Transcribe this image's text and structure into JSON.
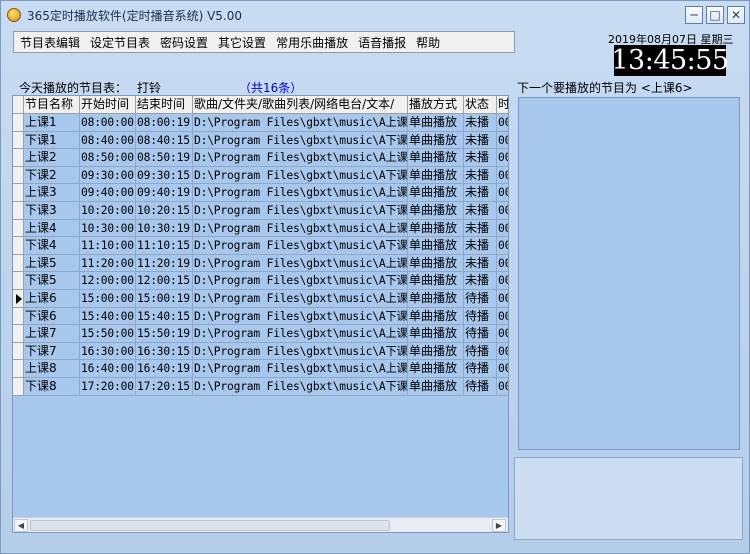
{
  "window": {
    "title": "365定时播放软件(定时播音系统) V5.00",
    "min_glyph": "─",
    "max_glyph": "□",
    "close_glyph": "✕"
  },
  "menu": [
    {
      "label": "节目表编辑"
    },
    {
      "label": "设定节目表"
    },
    {
      "label": "密码设置"
    },
    {
      "label": "其它设置"
    },
    {
      "label": "常用乐曲播放"
    },
    {
      "label": "语音播报"
    },
    {
      "label": "帮助"
    }
  ],
  "clock": {
    "date": "2019年08月07日 星期三",
    "time": "13:45:55"
  },
  "today": {
    "label": "今天播放的节目表：",
    "value": "打铃",
    "count": "（共16条）"
  },
  "next": {
    "label": "下一个要播放的节目为 <上课6>"
  },
  "table": {
    "headers": [
      "节目名称",
      "开始时间",
      "结束时间",
      "歌曲/文件夹/歌曲列表/网络电台/文本/",
      "播放方式",
      "状态",
      "时"
    ],
    "rows": [
      {
        "name": "上课1",
        "start": "08:00:00",
        "end": "08:00:19",
        "path": "D:\\Program Files\\gbxt\\music\\A上课",
        "mode": "单曲播放",
        "status": "未播",
        "extra": "00"
      },
      {
        "name": "下课1",
        "start": "08:40:00",
        "end": "08:40:15",
        "path": "D:\\Program Files\\gbxt\\music\\A下课",
        "mode": "单曲播放",
        "status": "未播",
        "extra": "00"
      },
      {
        "name": "上课2",
        "start": "08:50:00",
        "end": "08:50:19",
        "path": "D:\\Program Files\\gbxt\\music\\A上课",
        "mode": "单曲播放",
        "status": "未播",
        "extra": "00"
      },
      {
        "name": "下课2",
        "start": "09:30:00",
        "end": "09:30:15",
        "path": "D:\\Program Files\\gbxt\\music\\A下课",
        "mode": "单曲播放",
        "status": "未播",
        "extra": "00"
      },
      {
        "name": "上课3",
        "start": "09:40:00",
        "end": "09:40:19",
        "path": "D:\\Program Files\\gbxt\\music\\A上课",
        "mode": "单曲播放",
        "status": "未播",
        "extra": "00"
      },
      {
        "name": "下课3",
        "start": "10:20:00",
        "end": "10:20:15",
        "path": "D:\\Program Files\\gbxt\\music\\A下课",
        "mode": "单曲播放",
        "status": "未播",
        "extra": "00"
      },
      {
        "name": "上课4",
        "start": "10:30:00",
        "end": "10:30:19",
        "path": "D:\\Program Files\\gbxt\\music\\A上课",
        "mode": "单曲播放",
        "status": "未播",
        "extra": "00"
      },
      {
        "name": "下课4",
        "start": "11:10:00",
        "end": "11:10:15",
        "path": "D:\\Program Files\\gbxt\\music\\A下课",
        "mode": "单曲播放",
        "status": "未播",
        "extra": "00"
      },
      {
        "name": "上课5",
        "start": "11:20:00",
        "end": "11:20:19",
        "path": "D:\\Program Files\\gbxt\\music\\A上课",
        "mode": "单曲播放",
        "status": "未播",
        "extra": "00"
      },
      {
        "name": "下课5",
        "start": "12:00:00",
        "end": "12:00:15",
        "path": "D:\\Program Files\\gbxt\\music\\A下课",
        "mode": "单曲播放",
        "status": "未播",
        "extra": "00"
      },
      {
        "name": "上课6",
        "start": "15:00:00",
        "end": "15:00:19",
        "path": "D:\\Program Files\\gbxt\\music\\A上课",
        "mode": "单曲播放",
        "status": "待播",
        "extra": "00",
        "current": true
      },
      {
        "name": "下课6",
        "start": "15:40:00",
        "end": "15:40:15",
        "path": "D:\\Program Files\\gbxt\\music\\A下课",
        "mode": "单曲播放",
        "status": "待播",
        "extra": "00"
      },
      {
        "name": "上课7",
        "start": "15:50:00",
        "end": "15:50:19",
        "path": "D:\\Program Files\\gbxt\\music\\A上课",
        "mode": "单曲播放",
        "status": "待播",
        "extra": "00"
      },
      {
        "name": "下课7",
        "start": "16:30:00",
        "end": "16:30:15",
        "path": "D:\\Program Files\\gbxt\\music\\A下课",
        "mode": "单曲播放",
        "status": "待播",
        "extra": "00"
      },
      {
        "name": "上课8",
        "start": "16:40:00",
        "end": "16:40:19",
        "path": "D:\\Program Files\\gbxt\\music\\A上课",
        "mode": "单曲播放",
        "status": "待播",
        "extra": "00"
      },
      {
        "name": "下课8",
        "start": "17:20:00",
        "end": "17:20:15",
        "path": "D:\\Program Files\\gbxt\\music\\A下课",
        "mode": "单曲播放",
        "status": "待播",
        "extra": "00"
      }
    ]
  },
  "scrollbar": {
    "left_glyph": "◀",
    "right_glyph": "▶"
  },
  "colors": {
    "grid_bg": "#a7c7ed",
    "clock_bg": "#000000",
    "count_text": "#0000cc"
  }
}
